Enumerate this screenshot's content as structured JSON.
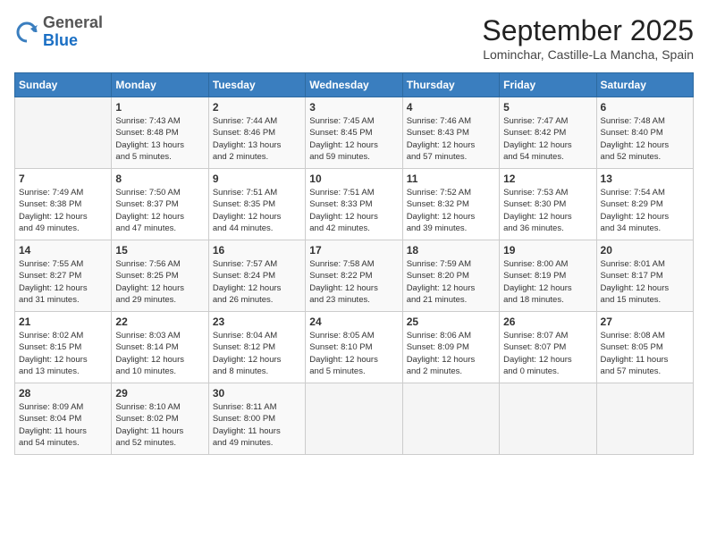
{
  "logo": {
    "general": "General",
    "blue": "Blue"
  },
  "title": "September 2025",
  "subtitle": "Lominchar, Castille-La Mancha, Spain",
  "headers": [
    "Sunday",
    "Monday",
    "Tuesday",
    "Wednesday",
    "Thursday",
    "Friday",
    "Saturday"
  ],
  "weeks": [
    [
      {
        "day": "",
        "info": ""
      },
      {
        "day": "1",
        "info": "Sunrise: 7:43 AM\nSunset: 8:48 PM\nDaylight: 13 hours\nand 5 minutes."
      },
      {
        "day": "2",
        "info": "Sunrise: 7:44 AM\nSunset: 8:46 PM\nDaylight: 13 hours\nand 2 minutes."
      },
      {
        "day": "3",
        "info": "Sunrise: 7:45 AM\nSunset: 8:45 PM\nDaylight: 12 hours\nand 59 minutes."
      },
      {
        "day": "4",
        "info": "Sunrise: 7:46 AM\nSunset: 8:43 PM\nDaylight: 12 hours\nand 57 minutes."
      },
      {
        "day": "5",
        "info": "Sunrise: 7:47 AM\nSunset: 8:42 PM\nDaylight: 12 hours\nand 54 minutes."
      },
      {
        "day": "6",
        "info": "Sunrise: 7:48 AM\nSunset: 8:40 PM\nDaylight: 12 hours\nand 52 minutes."
      }
    ],
    [
      {
        "day": "7",
        "info": "Sunrise: 7:49 AM\nSunset: 8:38 PM\nDaylight: 12 hours\nand 49 minutes."
      },
      {
        "day": "8",
        "info": "Sunrise: 7:50 AM\nSunset: 8:37 PM\nDaylight: 12 hours\nand 47 minutes."
      },
      {
        "day": "9",
        "info": "Sunrise: 7:51 AM\nSunset: 8:35 PM\nDaylight: 12 hours\nand 44 minutes."
      },
      {
        "day": "10",
        "info": "Sunrise: 7:51 AM\nSunset: 8:33 PM\nDaylight: 12 hours\nand 42 minutes."
      },
      {
        "day": "11",
        "info": "Sunrise: 7:52 AM\nSunset: 8:32 PM\nDaylight: 12 hours\nand 39 minutes."
      },
      {
        "day": "12",
        "info": "Sunrise: 7:53 AM\nSunset: 8:30 PM\nDaylight: 12 hours\nand 36 minutes."
      },
      {
        "day": "13",
        "info": "Sunrise: 7:54 AM\nSunset: 8:29 PM\nDaylight: 12 hours\nand 34 minutes."
      }
    ],
    [
      {
        "day": "14",
        "info": "Sunrise: 7:55 AM\nSunset: 8:27 PM\nDaylight: 12 hours\nand 31 minutes."
      },
      {
        "day": "15",
        "info": "Sunrise: 7:56 AM\nSunset: 8:25 PM\nDaylight: 12 hours\nand 29 minutes."
      },
      {
        "day": "16",
        "info": "Sunrise: 7:57 AM\nSunset: 8:24 PM\nDaylight: 12 hours\nand 26 minutes."
      },
      {
        "day": "17",
        "info": "Sunrise: 7:58 AM\nSunset: 8:22 PM\nDaylight: 12 hours\nand 23 minutes."
      },
      {
        "day": "18",
        "info": "Sunrise: 7:59 AM\nSunset: 8:20 PM\nDaylight: 12 hours\nand 21 minutes."
      },
      {
        "day": "19",
        "info": "Sunrise: 8:00 AM\nSunset: 8:19 PM\nDaylight: 12 hours\nand 18 minutes."
      },
      {
        "day": "20",
        "info": "Sunrise: 8:01 AM\nSunset: 8:17 PM\nDaylight: 12 hours\nand 15 minutes."
      }
    ],
    [
      {
        "day": "21",
        "info": "Sunrise: 8:02 AM\nSunset: 8:15 PM\nDaylight: 12 hours\nand 13 minutes."
      },
      {
        "day": "22",
        "info": "Sunrise: 8:03 AM\nSunset: 8:14 PM\nDaylight: 12 hours\nand 10 minutes."
      },
      {
        "day": "23",
        "info": "Sunrise: 8:04 AM\nSunset: 8:12 PM\nDaylight: 12 hours\nand 8 minutes."
      },
      {
        "day": "24",
        "info": "Sunrise: 8:05 AM\nSunset: 8:10 PM\nDaylight: 12 hours\nand 5 minutes."
      },
      {
        "day": "25",
        "info": "Sunrise: 8:06 AM\nSunset: 8:09 PM\nDaylight: 12 hours\nand 2 minutes."
      },
      {
        "day": "26",
        "info": "Sunrise: 8:07 AM\nSunset: 8:07 PM\nDaylight: 12 hours\nand 0 minutes."
      },
      {
        "day": "27",
        "info": "Sunrise: 8:08 AM\nSunset: 8:05 PM\nDaylight: 11 hours\nand 57 minutes."
      }
    ],
    [
      {
        "day": "28",
        "info": "Sunrise: 8:09 AM\nSunset: 8:04 PM\nDaylight: 11 hours\nand 54 minutes."
      },
      {
        "day": "29",
        "info": "Sunrise: 8:10 AM\nSunset: 8:02 PM\nDaylight: 11 hours\nand 52 minutes."
      },
      {
        "day": "30",
        "info": "Sunrise: 8:11 AM\nSunset: 8:00 PM\nDaylight: 11 hours\nand 49 minutes."
      },
      {
        "day": "",
        "info": ""
      },
      {
        "day": "",
        "info": ""
      },
      {
        "day": "",
        "info": ""
      },
      {
        "day": "",
        "info": ""
      }
    ]
  ]
}
